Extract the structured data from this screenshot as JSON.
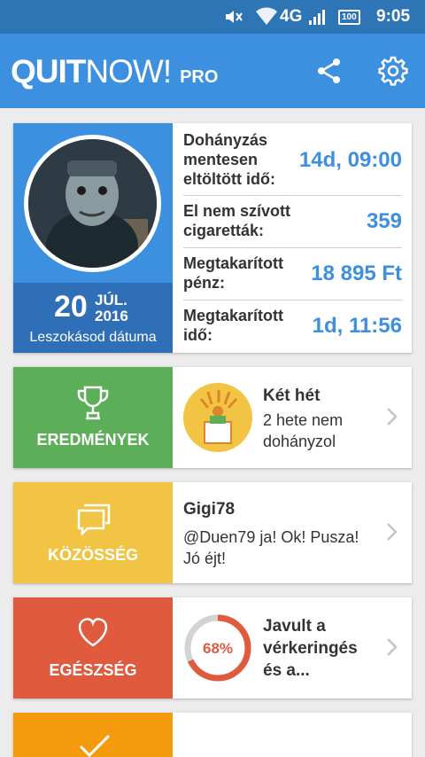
{
  "status_bar": {
    "network": "4G",
    "battery": "100",
    "time": "9:05"
  },
  "app_bar": {
    "logo_quit": "QUIT",
    "logo_now": "NOW!",
    "logo_pro": "PRO"
  },
  "profile": {
    "quit_day": "20",
    "quit_month": "JÚL.",
    "quit_year": "2016",
    "quit_date_label": "Leszokásod dátuma",
    "stats": [
      {
        "label_lines": [
          "Dohányzás",
          "mentesen",
          "eltöltött idő:"
        ],
        "value": "14d, 09:00"
      },
      {
        "label_lines": [
          "El nem szívott",
          "cigaretták:"
        ],
        "value": "359"
      },
      {
        "label_lines": [
          "Megtakarított",
          "pénz:"
        ],
        "value": "18 895 Ft"
      },
      {
        "label_lines": [
          "Megtakarított",
          "idő:"
        ],
        "value": "1d, 11:56"
      }
    ]
  },
  "achievements": {
    "title": "EREDMÉNYEK",
    "item_title": "Két hét",
    "item_desc": "2 hete nem dohányzol",
    "color": "#5cae58"
  },
  "community": {
    "title": "KÖZÖSSÉG",
    "user": "Gigi78",
    "message": "@Duen79 ja! Ok! Pusza! Jó éjt!",
    "color": "#f2c443"
  },
  "health": {
    "title": "EGÉSZSÉG",
    "percent_label": "68%",
    "percent": 68,
    "text": "Javult a vérkeringés és a...",
    "color": "#e05a3e"
  },
  "colors": {
    "status_bar": "#2e75b6",
    "app_bar": "#3d8fe0",
    "accent_value": "#3d8fe0",
    "health_ring": "#e05a3e"
  }
}
